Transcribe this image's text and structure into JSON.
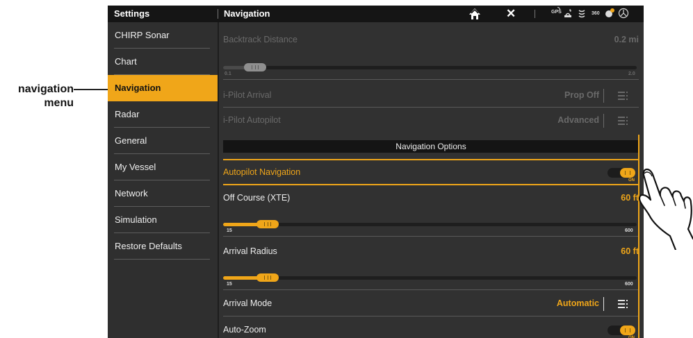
{
  "annotation": {
    "line1": "navigation",
    "line2": "menu"
  },
  "topbar": {
    "settings_title": "Settings",
    "pane_title": "Navigation",
    "home_icon": "home-icon",
    "close_icon": "close-icon",
    "status": {
      "gps": "GPS",
      "threesixty": "360"
    }
  },
  "sidebar": {
    "items": [
      {
        "label": "CHIRP Sonar",
        "active": false
      },
      {
        "label": "Chart",
        "active": false
      },
      {
        "label": "Navigation",
        "active": true
      },
      {
        "label": "Radar",
        "active": false
      },
      {
        "label": "General",
        "active": false
      },
      {
        "label": "My Vessel",
        "active": false
      },
      {
        "label": "Network",
        "active": false
      },
      {
        "label": "Simulation",
        "active": false
      },
      {
        "label": "Restore Defaults",
        "active": false
      }
    ]
  },
  "pane": {
    "backtrack": {
      "label": "Backtrack Distance",
      "value": "0.2 mi",
      "min": "0.1",
      "max": "2.0",
      "slider_fraction": 0.05,
      "enabled": false
    },
    "ipilot_arrival": {
      "label": "i-Pilot Arrival",
      "value": "Prop Off",
      "enabled": false
    },
    "ipilot_autopilot": {
      "label": "i-Pilot Autopilot",
      "value": "Advanced",
      "enabled": false
    },
    "section_title": "Navigation Options",
    "autopilot_nav": {
      "label": "Autopilot Navigation",
      "state": "on",
      "state_label": "ON"
    },
    "off_course": {
      "label": "Off Course (XTE)",
      "value": "60 ft",
      "min": "15",
      "max": "600",
      "slider_fraction": 0.08
    },
    "arrival_radius": {
      "label": "Arrival Radius",
      "value": "60 ft",
      "min": "15",
      "max": "600",
      "slider_fraction": 0.08
    },
    "arrival_mode": {
      "label": "Arrival Mode",
      "value": "Automatic"
    },
    "auto_zoom": {
      "label": "Auto-Zoom",
      "state": "on",
      "state_label": "ON"
    }
  },
  "colors": {
    "accent": "#f0a619",
    "background": "#313131",
    "topbar": "#151515",
    "dim_text": "#6a6a6a"
  }
}
